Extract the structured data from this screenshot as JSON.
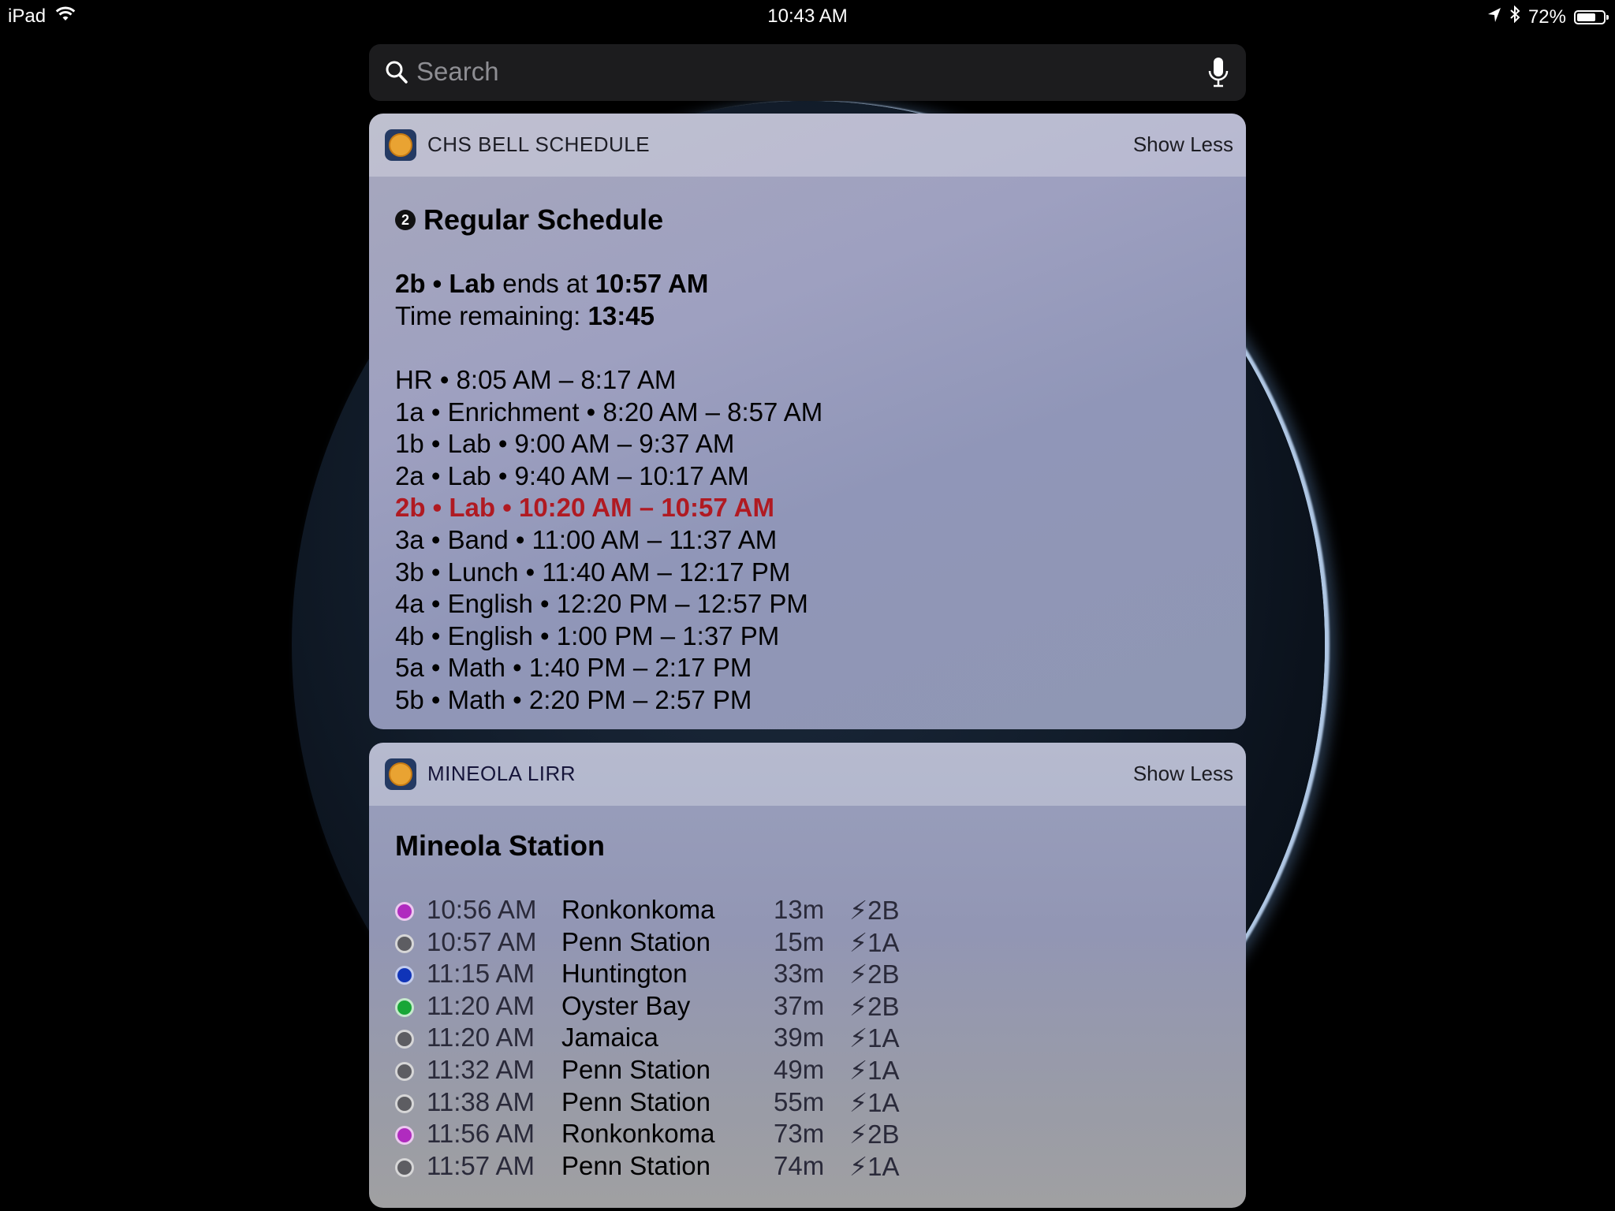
{
  "status_bar": {
    "device": "iPad",
    "time": "10:43 AM",
    "battery": "72%",
    "battery_level": 0.72
  },
  "search": {
    "placeholder": "Search"
  },
  "bell_widget": {
    "app_title": "CHS BELL SCHEDULE",
    "show_less": "Show Less",
    "day_number": "2",
    "schedule_title": "Regular Schedule",
    "current_period": "2b • Lab",
    "ends_at_text": "ends at",
    "ends_at_time": "10:57 AM",
    "time_remaining_label": "Time remaining:",
    "time_remaining": "13:45",
    "periods": [
      "HR • 8:05 AM – 8:17 AM",
      "1a • Enrichment • 8:20 AM – 8:57 AM",
      "1b • Lab • 9:00 AM – 9:37 AM",
      "2a • Lab • 9:40 AM – 10:17 AM",
      "2b • Lab • 10:20 AM – 10:57 AM",
      "3a • Band • 11:00 AM – 11:37 AM",
      "3b • Lunch • 11:40 AM – 12:17 PM",
      "4a • English • 12:20 PM – 12:57 PM",
      "4b • English • 1:00 PM – 1:37 PM",
      "5a • Math • 1:40 PM – 2:17 PM",
      "5b • Math • 2:20 PM – 2:57 PM"
    ],
    "current_index": 4,
    "current_color": "#b01a22"
  },
  "lirr_widget": {
    "app_title": "MINEOLA LIRR",
    "show_less": "Show Less",
    "station": "Mineola Station",
    "trains": [
      {
        "time": "10:56 AM",
        "destination": "Ronkonkoma",
        "mins": "13m",
        "track": "⚡︎2B",
        "color": "#b02bbf"
      },
      {
        "time": "10:57 AM",
        "destination": "Penn Station",
        "mins": "15m",
        "track": "⚡︎1A",
        "color": "#5d5d62"
      },
      {
        "time": "11:15 AM",
        "destination": "Huntington",
        "mins": "33m",
        "track": "⚡︎2B",
        "color": "#1034b8"
      },
      {
        "time": "11:20 AM",
        "destination": "Oyster Bay",
        "mins": "37m",
        "track": "⚡︎2B",
        "color": "#18a636"
      },
      {
        "time": "11:20 AM",
        "destination": "Jamaica",
        "mins": "39m",
        "track": "⚡︎1A",
        "color": "#5d5d62"
      },
      {
        "time": "11:32 AM",
        "destination": "Penn Station",
        "mins": "49m",
        "track": "⚡︎1A",
        "color": "#5d5d62"
      },
      {
        "time": "11:38 AM",
        "destination": "Penn Station",
        "mins": "55m",
        "track": "⚡︎1A",
        "color": "#5d5d62"
      },
      {
        "time": "11:56 AM",
        "destination": "Ronkonkoma",
        "mins": "73m",
        "track": "⚡︎2B",
        "color": "#b02bbf"
      },
      {
        "time": "11:57 AM",
        "destination": "Penn Station",
        "mins": "74m",
        "track": "⚡︎1A",
        "color": "#5d5d62"
      }
    ]
  },
  "icons": [
    "wifi-icon",
    "location-arrow-icon",
    "bluetooth-icon",
    "battery-icon",
    "search-icon",
    "microphone-icon",
    "app-seal-icon"
  ]
}
